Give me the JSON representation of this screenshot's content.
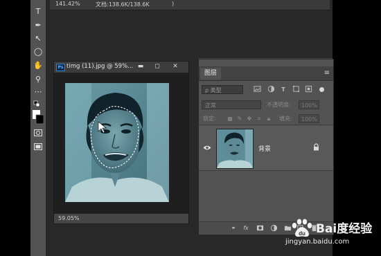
{
  "top_document": {
    "zoom": "141.42%",
    "doc_size": "文档:138.6K/138.6K",
    "arrow": ")"
  },
  "image_window": {
    "badge": "Ps",
    "title": "timg (11).jpg @ 59%...",
    "minimize": "▬",
    "maximize": "◻",
    "close": "✕",
    "zoom_status": "59.05%"
  },
  "tools": [
    {
      "name": "type-tool-icon",
      "glyph": "T"
    },
    {
      "name": "pen-tool-icon",
      "glyph": "✒"
    },
    {
      "name": "path-select-icon",
      "glyph": "↖"
    },
    {
      "name": "rectangle-tool-icon",
      "glyph": "▭"
    },
    {
      "name": "ellipse-tool-icon",
      "glyph": "◯"
    },
    {
      "name": "hand-tool-icon",
      "glyph": "✋"
    },
    {
      "name": "zoom-tool-icon",
      "glyph": "⚲"
    },
    {
      "name": "more-tools-icon",
      "glyph": "⋯"
    }
  ],
  "layers_panel": {
    "collapse_icon": "»",
    "close_icon": "✕",
    "tab_label": "图层",
    "menu_icon": "≡",
    "filter": {
      "kind_label": "ρ 类型",
      "icons": [
        "image-filter-icon",
        "adjustment-filter-icon",
        "type-filter-icon",
        "shape-filter-icon",
        "smart-object-filter-icon"
      ]
    },
    "blend_mode": "正常",
    "opacity_label": "不透明度:",
    "opacity_value": "100%",
    "lock_label": "锁定:",
    "fill_label": "填充:",
    "fill_value": "100%",
    "layers": [
      {
        "name": "背景",
        "visible": true,
        "locked": true
      }
    ],
    "footer_icons": [
      "link-layers-icon",
      "fx-icon",
      "add-mask-icon",
      "adjustment-layer-icon",
      "group-folder-icon",
      "new-layer-icon",
      "delete-layer-icon"
    ]
  },
  "watermark": {
    "brand": "Bai度经验",
    "url": "jingyan.baidu.com"
  }
}
